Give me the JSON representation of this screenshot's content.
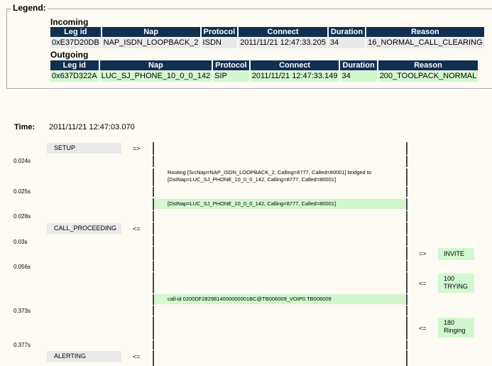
{
  "legend": {
    "title": "Legend:",
    "incoming": {
      "title": "Incoming",
      "headers": [
        "Leg id",
        "Nap",
        "Protocol",
        "Connect",
        "Duration",
        "Reason"
      ],
      "row": [
        "0xE37D20DB",
        "NAP_ISDN_LOOPBACK_2",
        "ISDN",
        "2011/11/21 12:47:33.205",
        "34",
        "16_NORMAL_CALL_CLEARING"
      ]
    },
    "outgoing": {
      "title": "Outgoing",
      "headers": [
        "Leg id",
        "Nap",
        "Protocol",
        "Connect",
        "Duration",
        "Reason"
      ],
      "row": [
        "0x637D322A",
        "LUC_SJ_PHONE_10_0_0_142",
        "SIP",
        "2011/11/21 12:47:33.149",
        "34",
        "200_TOOLPACK_NORMAL"
      ]
    }
  },
  "time": {
    "label": "Time:",
    "value": "2011/11/21 12:47:03.070"
  },
  "ticks": [
    "0.024s",
    "0.025s",
    "0.028s",
    "0.03s",
    "0.056s",
    "0.373s",
    "0.377s"
  ],
  "left_messages": [
    {
      "label": "SETUP",
      "arrow": "=>"
    },
    {
      "label": "CALL_PROCEEDING",
      "arrow": "<="
    },
    {
      "label": "ALERTING",
      "arrow": "<="
    }
  ],
  "notes": {
    "routing_line1": "Routing [SrcNap=NAP_ISDN_LOOPBACK_2, Calling=8777, Called=80001] bridged to",
    "routing_line2": "[DstNap=LUC_SJ_PHONE_10_0_0_142, Calling=8777, Called=80001]",
    "dst": "[DstNap=LUC_SJ_PHONE_10_0_0_142, Calling=8777, Called=80001]",
    "callid": "call-id 0200DF2829814000000001BC@TB006009_VOIP0.TB006009"
  },
  "right_messages": [
    {
      "line1": "INVITE",
      "line2": "",
      "arrow": "=>"
    },
    {
      "line1": "100",
      "line2": "TRYING",
      "arrow": "<="
    },
    {
      "line1": "180",
      "line2": "Ringing",
      "arrow": "<="
    }
  ],
  "colors": {
    "header_bg": "#103050",
    "incoming_row": "#eaeaea",
    "outgoing_row": "#d2f8d0",
    "background": "#fdfbf3"
  }
}
